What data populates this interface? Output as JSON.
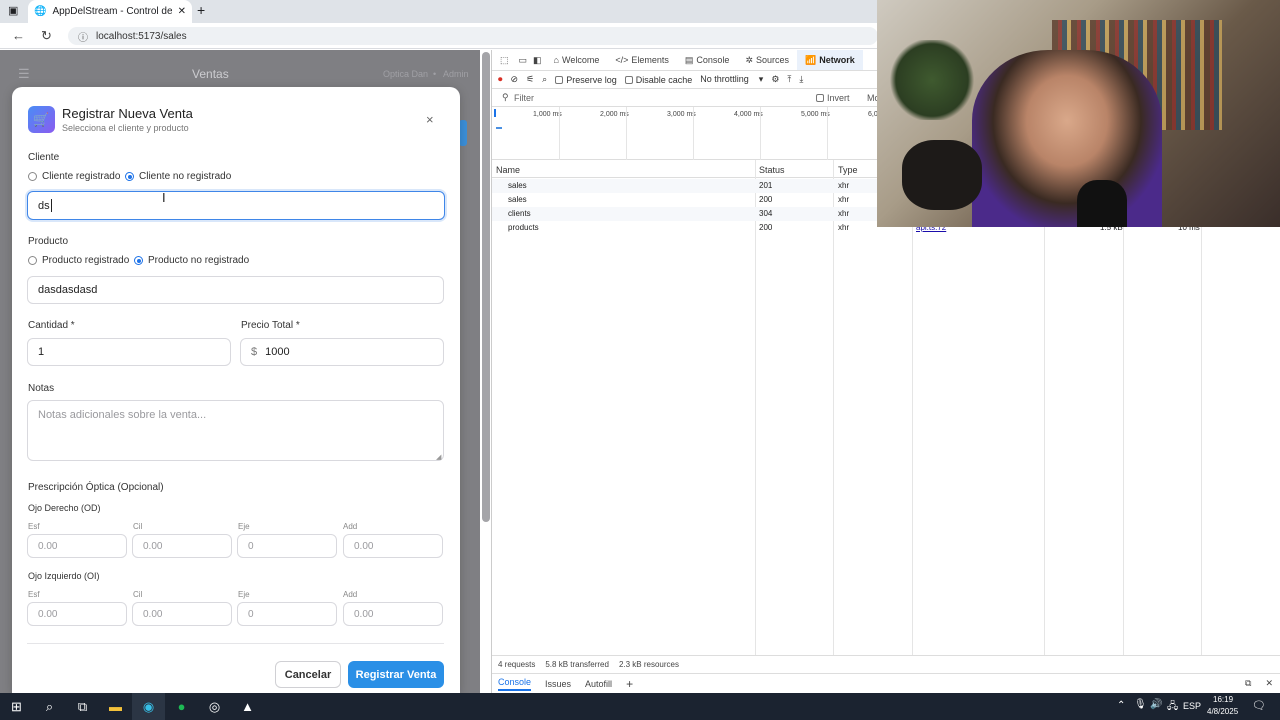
{
  "browser": {
    "tab_title": "AppDelStream - Control de Stock",
    "url": "localhost:5173/sales"
  },
  "app": {
    "header_title": "Ventas",
    "header_store": "Optica Dan",
    "header_user": "Admin",
    "header_sep": "•"
  },
  "modal": {
    "title": "Registrar Nueva Venta",
    "subtitle": "Selecciona el cliente y producto",
    "client_label": "Cliente",
    "client_opt_registered": "Cliente registrado",
    "client_opt_unregistered": "Cliente no registrado",
    "client_value": "ds",
    "product_label": "Producto",
    "product_opt_registered": "Producto registrado",
    "product_opt_unregistered": "Producto no registrado",
    "product_value": "dasdasdasd",
    "quantity_label": "Cantidad *",
    "quantity_value": "1",
    "price_label": "Precio Total *",
    "price_symbol": "$",
    "price_value": "1000",
    "notes_label": "Notas",
    "notes_placeholder": "Notas adicionales sobre la venta...",
    "prescription_title": "Prescripción Óptica (Opcional)",
    "od_label": "Ojo Derecho (OD)",
    "oi_label": "Ojo Izquierdo (OI)",
    "esf_label": "Esf",
    "cil_label": "Cil",
    "eje_label": "Eje",
    "add_label": "Add",
    "ph_decimal": "0.00",
    "ph_axis": "0",
    "cancel_label": "Cancelar",
    "submit_label": "Registrar Venta"
  },
  "devtools": {
    "tabs": [
      "Welcome",
      "Elements",
      "Console",
      "Sources",
      "Network"
    ],
    "preserve_log": "Preserve log",
    "disable_cache": "Disable cache",
    "throttling": "No throttling",
    "filter_placeholder": "Filter",
    "invert": "Invert",
    "more": "Mo",
    "ticks": [
      "1,000 ms",
      "2,000 ms",
      "3,000 ms",
      "4,000 ms",
      "5,000 ms",
      "6,0"
    ],
    "columns": {
      "name": "Name",
      "status": "Status",
      "type": "Type"
    },
    "requests": [
      {
        "name": "sales",
        "status": "201",
        "type": "xhr"
      },
      {
        "name": "sales",
        "status": "200",
        "type": "xhr"
      },
      {
        "name": "clients",
        "status": "304",
        "type": "xhr"
      },
      {
        "name": "products",
        "status": "200",
        "type": "xhr"
      }
    ],
    "partial_initiator": "api.ts:72",
    "partial_size": "1.5 kB",
    "partial_time": "10 ms",
    "status_requests": "4 requests",
    "status_transferred": "5.8 kB transferred",
    "status_resources": "2.3 kB resources",
    "drawer_tabs": [
      "Console",
      "Issues",
      "Autofill"
    ]
  },
  "taskbar": {
    "lang": "ESP",
    "time": "16:19",
    "date": "4/8/2025"
  },
  "colors": {
    "primary": "#1e73e8",
    "submit": "#2a8fe6",
    "overlay": "#7f7f83",
    "taskbar": "#1b2330"
  }
}
